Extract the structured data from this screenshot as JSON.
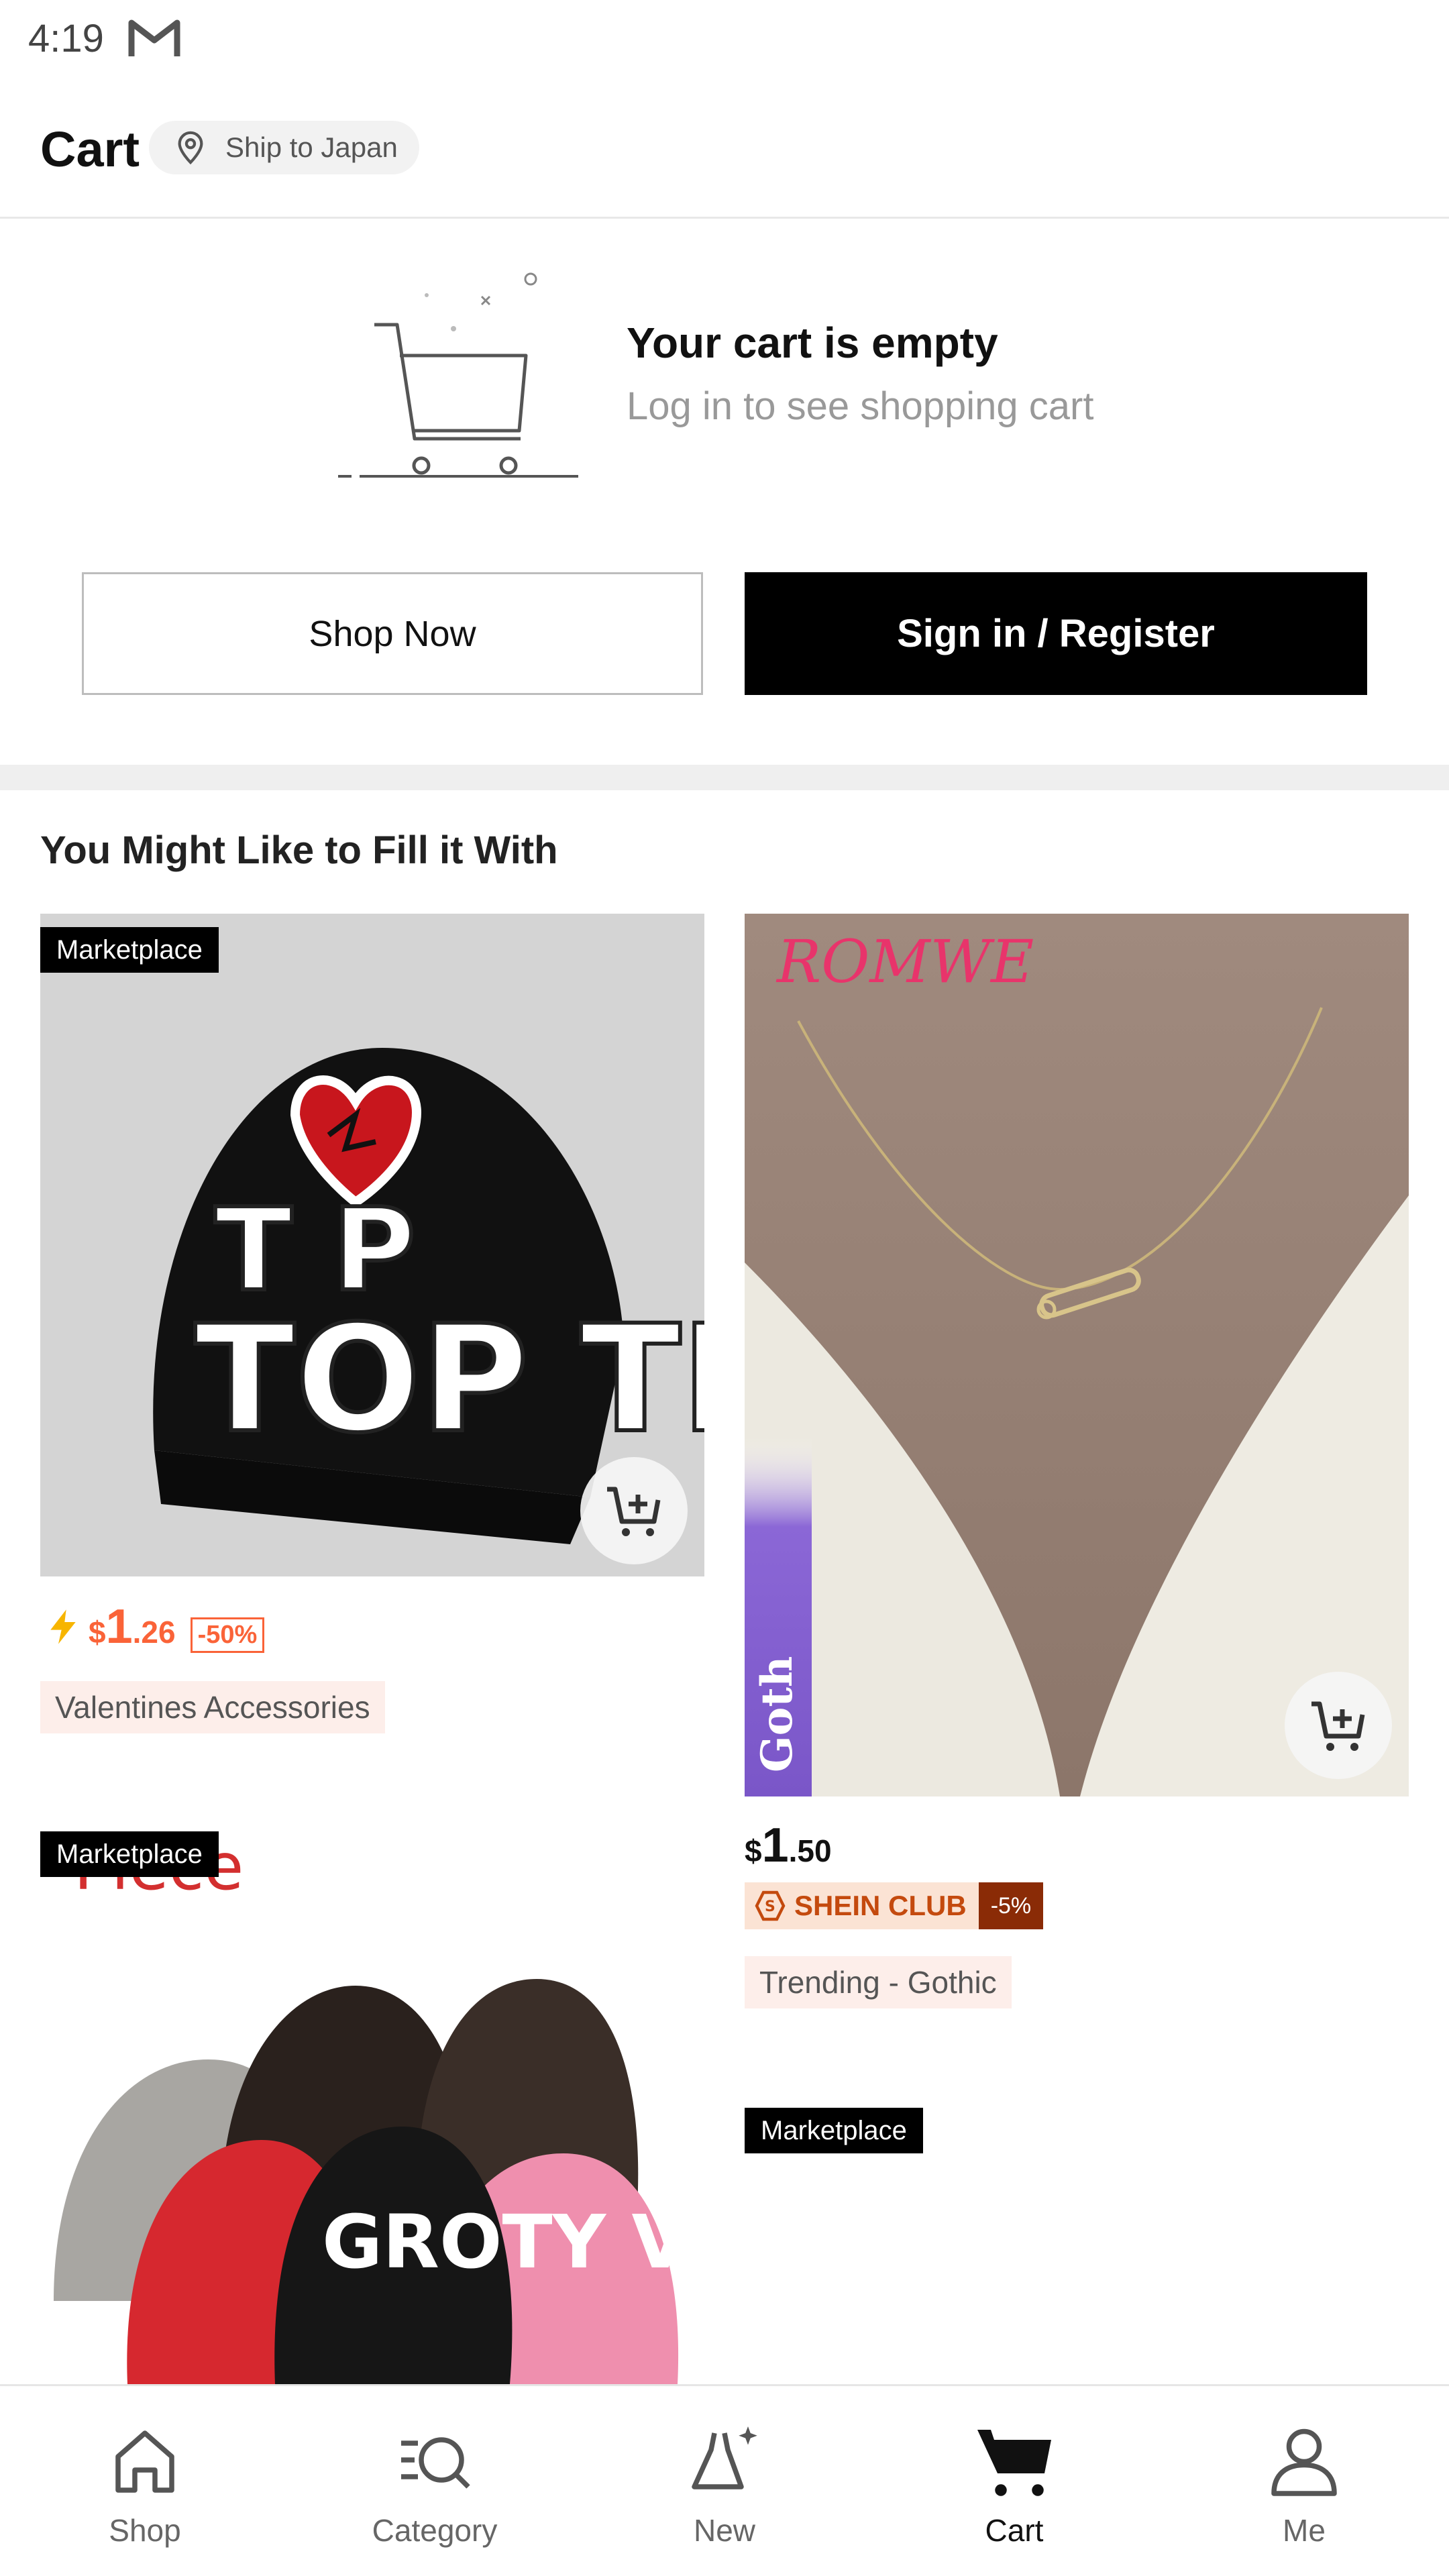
{
  "status_bar": {
    "time": "4:19",
    "notification_icon": "gmail-icon"
  },
  "header": {
    "title": "Cart",
    "ship_label": "Ship to Japan",
    "ship_icon": "location-pin-icon"
  },
  "empty_cart": {
    "title": "Your cart is empty",
    "subtitle": "Log in to see shopping cart",
    "illustration": "empty-cart-icon"
  },
  "buttons": {
    "shop_now": "Shop Now",
    "sign_in": "Sign in / Register"
  },
  "recommendations": {
    "title": "You Might Like to Fill it With",
    "products": [
      {
        "tag": "Marketplace",
        "image_text": "TOP TIER",
        "price_currency": "$",
        "price_int": "1",
        "price_dec": ".26",
        "discount": "-50%",
        "flash_icon": "lightning-icon",
        "chip": "Valentines Accessories"
      },
      {
        "brand": "ROMWE",
        "side_label": "Goth",
        "price_currency": "$",
        "price_int": "1",
        "price_dec": ".50",
        "club_label": "SHEIN CLUB",
        "club_discount": "-5%",
        "chip": "Trending - Gothic"
      },
      {
        "tag": "Marketplace",
        "image_caption": "Piece",
        "image_text": "GROTY VISONS"
      },
      {
        "tag": "Marketplace"
      }
    ]
  },
  "bottom_nav": [
    {
      "label": "Shop",
      "icon": "home-icon",
      "active": false
    },
    {
      "label": "Category",
      "icon": "category-search-icon",
      "active": false
    },
    {
      "label": "New",
      "icon": "dress-sparkle-icon",
      "active": false
    },
    {
      "label": "Cart",
      "icon": "cart-icon",
      "active": true
    },
    {
      "label": "Me",
      "icon": "person-icon",
      "active": false
    }
  ],
  "colors": {
    "accent": "#fa6338",
    "black": "#000000",
    "club_dark": "#8a2b06",
    "brand_pink": "#e8346b",
    "goth_purple": "#8b67d6"
  }
}
